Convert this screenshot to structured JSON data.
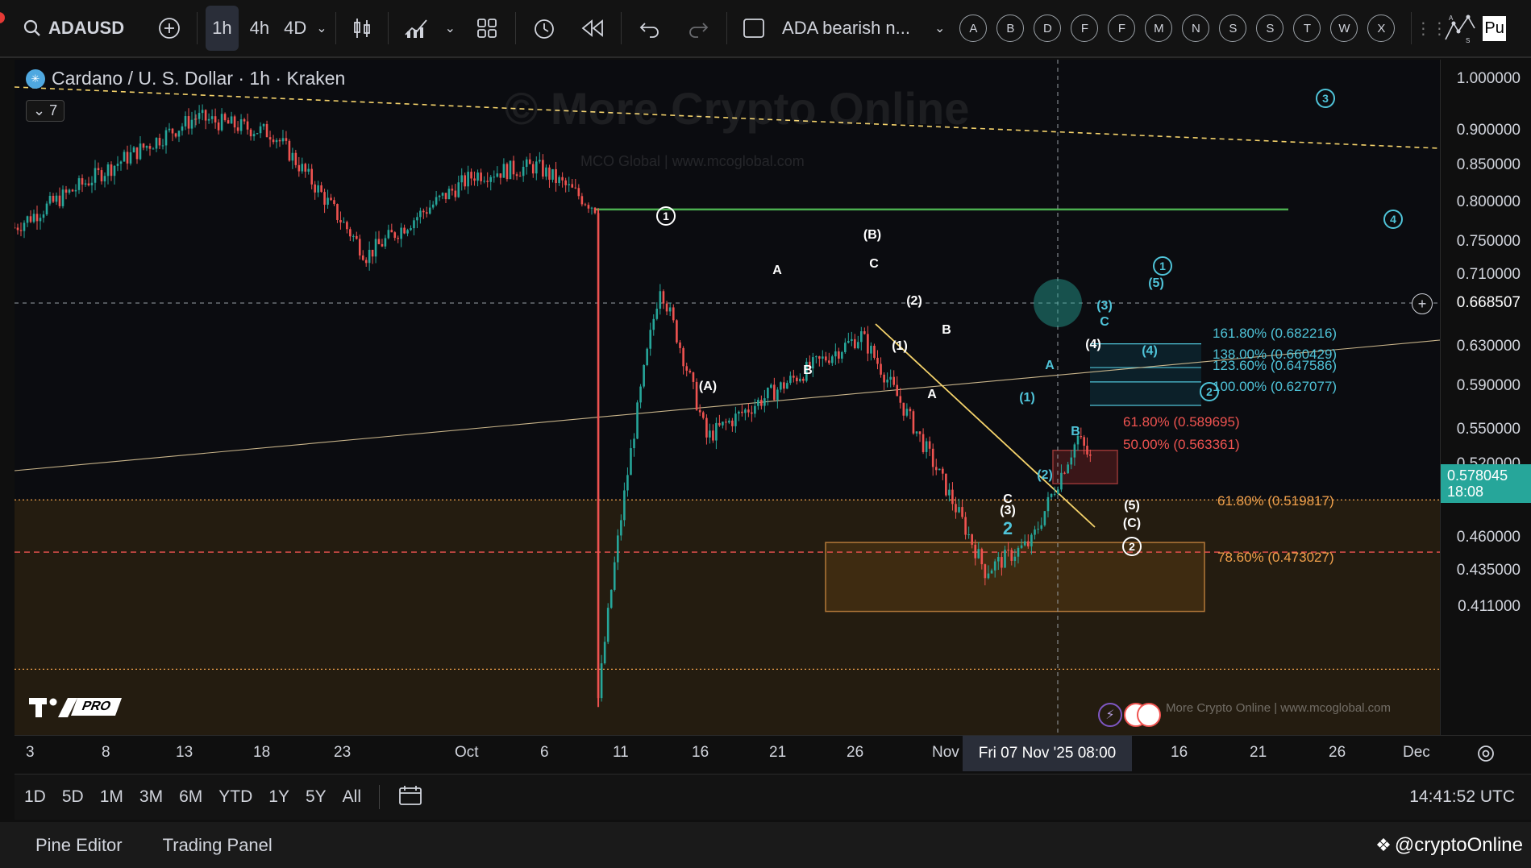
{
  "toolbar": {
    "symbol": "ADAUSD",
    "intervals": [
      "1h",
      "4h",
      "4D"
    ],
    "active_interval": "1h",
    "layout_name": "ADA bearish n...",
    "alert_letters": [
      "A",
      "B",
      "D",
      "F",
      "F",
      "M",
      "N",
      "S",
      "S",
      "T",
      "W",
      "X"
    ],
    "right_label": "Pu"
  },
  "legend": {
    "title": "Cardano / U. S. Dollar · 1h · Kraken",
    "indicator_count": "7"
  },
  "watermark": {
    "main": "© More Crypto Online",
    "sub": "MCO Global  |  www.mcoglobal.com",
    "footer": "More Crypto Online  |  www.mcoglobal.com"
  },
  "logo_text": "PRO",
  "price_axis": {
    "labels": [
      "1.000000",
      "0.900000",
      "0.850000",
      "0.800000",
      "0.750000",
      "0.710000",
      "0.630000",
      "0.590000",
      "0.550000",
      "0.520000",
      "0.490000",
      "0.460000",
      "0.435000",
      "0.411000"
    ],
    "crosshair_price": "0.668507",
    "current_price": "0.578045",
    "countdown": "18:08"
  },
  "time_axis": {
    "labels": [
      "3",
      "8",
      "13",
      "18",
      "23",
      "Oct",
      "6",
      "11",
      "16",
      "21",
      "26",
      "Nov",
      "16",
      "21",
      "26",
      "Dec"
    ],
    "crosshair_time": "Fri 07 Nov '25   08:00"
  },
  "fib_levels": {
    "upper": [
      {
        "label": "161.80% (0.682216)",
        "color": "#4fc3d8"
      },
      {
        "label": "138.00% (0.660429)",
        "color": "#4fc3d8"
      },
      {
        "label": "123.60% (0.647586)",
        "color": "#4fc3d8"
      },
      {
        "label": "100.00% (0.627077)",
        "color": "#4fc3d8"
      }
    ],
    "mid": [
      {
        "label": "61.80% (0.589695)",
        "color": "#ef5350"
      },
      {
        "label": "50.00% (0.563361)",
        "color": "#ef5350"
      }
    ],
    "lower": [
      {
        "label": "61.80% (0.519817)",
        "color": "#f0a04b"
      },
      {
        "label": "78.60% (0.473027)",
        "color": "#f0a04b"
      }
    ]
  },
  "wave_labels": {
    "white": [
      "(B)",
      "C",
      "A",
      "B",
      "(A)",
      "(2)",
      "B",
      "(1)",
      "A",
      "(4)",
      "C",
      "(3)",
      "(5)",
      "(C)"
    ],
    "cyan": [
      "(5)",
      "(3)",
      "C",
      "(4)",
      "A",
      "(1)",
      "B",
      "(2)",
      "2",
      "(3)"
    ],
    "circled_white": [
      "1",
      "2"
    ],
    "circled_cyan": [
      "3",
      "4",
      "1",
      "2"
    ]
  },
  "range_bar": {
    "ranges": [
      "1D",
      "5D",
      "1M",
      "3M",
      "6M",
      "YTD",
      "1Y",
      "5Y",
      "All"
    ],
    "clock": "14:41:52 UTC"
  },
  "bottom_bar": {
    "tabs": [
      "Pine Editor",
      "Trading Panel"
    ],
    "brand": "@cryptoOnline"
  },
  "colors": {
    "up": "#26a69a",
    "down": "#ef5350",
    "accent": "#2962ff",
    "green_line": "#4caf50",
    "fib_orange": "#f0a04b",
    "cyan": "#4fc3d8"
  },
  "chart_data": {
    "type": "candlestick",
    "symbol": "ADAUSD",
    "interval": "1h",
    "exchange": "Kraken",
    "y_scale": "log",
    "ylim": [
      0.411,
      1.0
    ],
    "x_range": [
      "Sep 3",
      "Dec 1"
    ],
    "key_points": [
      {
        "date": "Sep 14",
        "price": 0.93
      },
      {
        "date": "Sep 19",
        "price": 0.91
      },
      {
        "date": "Sep 25",
        "price": 0.77
      },
      {
        "date": "Oct 2",
        "price": 0.86
      },
      {
        "date": "Oct 6",
        "price": 0.87
      },
      {
        "date": "Oct 10",
        "price": 0.82
      },
      {
        "date": "Oct 10",
        "price": 0.42
      },
      {
        "date": "Oct 14",
        "price": 0.74
      },
      {
        "date": "Oct 17",
        "price": 0.6
      },
      {
        "date": "Oct 27",
        "price": 0.69
      },
      {
        "date": "Nov 4",
        "price": 0.5
      },
      {
        "date": "Nov 7",
        "price": 0.52
      },
      {
        "date": "Nov 10",
        "price": 0.6
      },
      {
        "date": "Nov 11",
        "price": 0.578
      }
    ],
    "horizontal_lines": [
      {
        "price": 0.82,
        "color": "green"
      },
      {
        "price": 0.551,
        "color": "orange-dotted"
      },
      {
        "price": 0.513,
        "color": "red-dashed"
      },
      {
        "price": 0.437,
        "color": "orange-dotted"
      }
    ]
  }
}
